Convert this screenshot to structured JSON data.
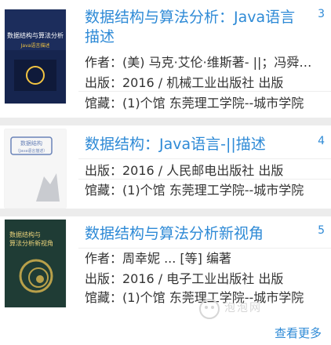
{
  "results": [
    {
      "number": "3",
      "title_lines": [
        "数据结构与算法分析：Java语言",
        "描述"
      ],
      "author": "作者：(美) 马克·艾伦·维斯著- ||；冯舜…",
      "publisher": "出版：2016 / 机械工业出版社 出版",
      "holdings": "馆藏：(1)个馆 东莞理工学院--城市学院",
      "cover": {
        "colors": [
          "#1c2d5c",
          "#16254f",
          "#f3c542"
        ],
        "lines": [
          "数据结构与算法分析",
          "Java语言描述"
        ]
      }
    },
    {
      "number": "4",
      "title": "数据结构：Java语言-||描述",
      "publisher": "出版：2016 / 人民邮电出版社 出版",
      "holdings": "馆藏：(1)个馆 东莞理工学院--城市学院",
      "cover": {
        "colors": [
          "#f6f6f6",
          "#6a83b8"
        ],
        "lines": [
          "数据结构",
          "（Java语言描述）"
        ]
      }
    },
    {
      "number": "5",
      "title": "数据结构与算法分析新视角",
      "author": "作者：周幸妮 ... [等] 编著",
      "publisher": "出版：2016 / 电子工业出版社 出版",
      "holdings": "馆藏：(1)个馆 东莞理工学院--城市学院",
      "cover": {
        "colors": [
          "#1f3c35",
          "#b8a04a",
          "#e9d27a"
        ],
        "lines": [
          "数据结构与",
          "算法分析新视角"
        ]
      }
    }
  ],
  "more_label": "查看更多",
  "watermark": "泡泡网"
}
